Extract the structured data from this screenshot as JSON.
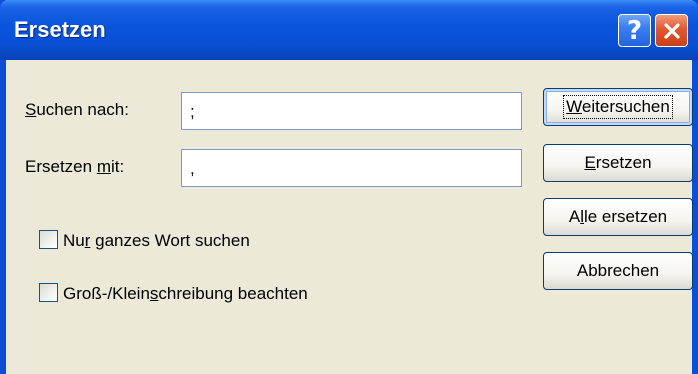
{
  "window": {
    "title": "Ersetzen",
    "help_glyph": "?"
  },
  "search": {
    "label_prefix": "",
    "label_accel": "S",
    "label_rest": "uchen nach:",
    "value": ";"
  },
  "replace": {
    "label_prefix": "Ersetzen ",
    "label_accel": "m",
    "label_rest": "it:",
    "value": ","
  },
  "options": {
    "whole_word": {
      "prefix": "Nu",
      "accel": "r",
      "rest": " ganzes Wort suchen",
      "checked": false
    },
    "match_case": {
      "prefix": "Groß-/Klein",
      "accel": "s",
      "rest": "chreibung beachten",
      "checked": false
    }
  },
  "buttons": {
    "find_next": {
      "prefix": "",
      "accel": "W",
      "rest": "eitersuchen"
    },
    "replace": {
      "prefix": "",
      "accel": "E",
      "rest": "rsetzen"
    },
    "replace_all": {
      "prefix": "A",
      "accel": "l",
      "rest": "le ersetzen"
    },
    "cancel": {
      "prefix": "Abbrechen",
      "accel": "",
      "rest": ""
    }
  },
  "icons": {
    "help": "help-icon",
    "close": "close-icon",
    "checkbox": "checkbox-icon"
  },
  "colors": {
    "titlebar": "#0a4fd6",
    "dialog_bg": "#ece9d8",
    "close_button": "#e2582f",
    "help_button": "#3a7ff0"
  }
}
